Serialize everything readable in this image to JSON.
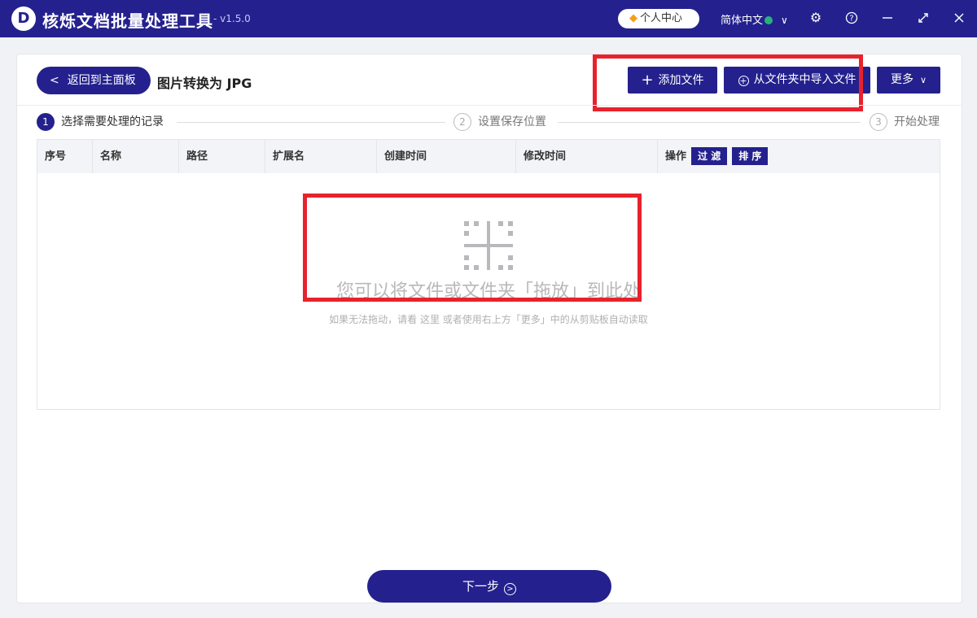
{
  "titlebar": {
    "logo_letter": "D",
    "app_title": "核烁文档批量处理工具",
    "version": "- v1.5.0",
    "vip_label": "个人中心",
    "language": "简体中文",
    "icons": [
      "diamond-icon",
      "globe-icon",
      "chevron-down-icon",
      "gear-icon",
      "help-icon",
      "minimize-icon",
      "maximize-icon",
      "close-icon"
    ]
  },
  "header": {
    "back_label": "返回到主面板",
    "page_title": "图片转换为 JPG",
    "add_file_label": "添加文件",
    "import_folder_label": "从文件夹中导入文件",
    "more_label": "更多"
  },
  "steps": [
    {
      "num": "1",
      "label": "选择需要处理的记录",
      "active": true
    },
    {
      "num": "2",
      "label": "设置保存位置",
      "active": false
    },
    {
      "num": "3",
      "label": "开始处理",
      "active": false
    }
  ],
  "table": {
    "columns": [
      "序号",
      "名称",
      "路径",
      "扩展名",
      "创建时间",
      "修改时间",
      "操作"
    ],
    "filter_label": "过 滤",
    "sort_label": "排 序",
    "rows": []
  },
  "empty_state": {
    "main_text": "您可以将文件或文件夹「拖放」到此处",
    "sub_text": "如果无法拖动，请看  这里  或者使用右上方「更多」中的从剪贴板自动读取"
  },
  "footer": {
    "next_label": "下一步"
  },
  "colors": {
    "brand": "#24218e",
    "highlight_box": "#e8222c",
    "background": "#f1f2f6"
  }
}
